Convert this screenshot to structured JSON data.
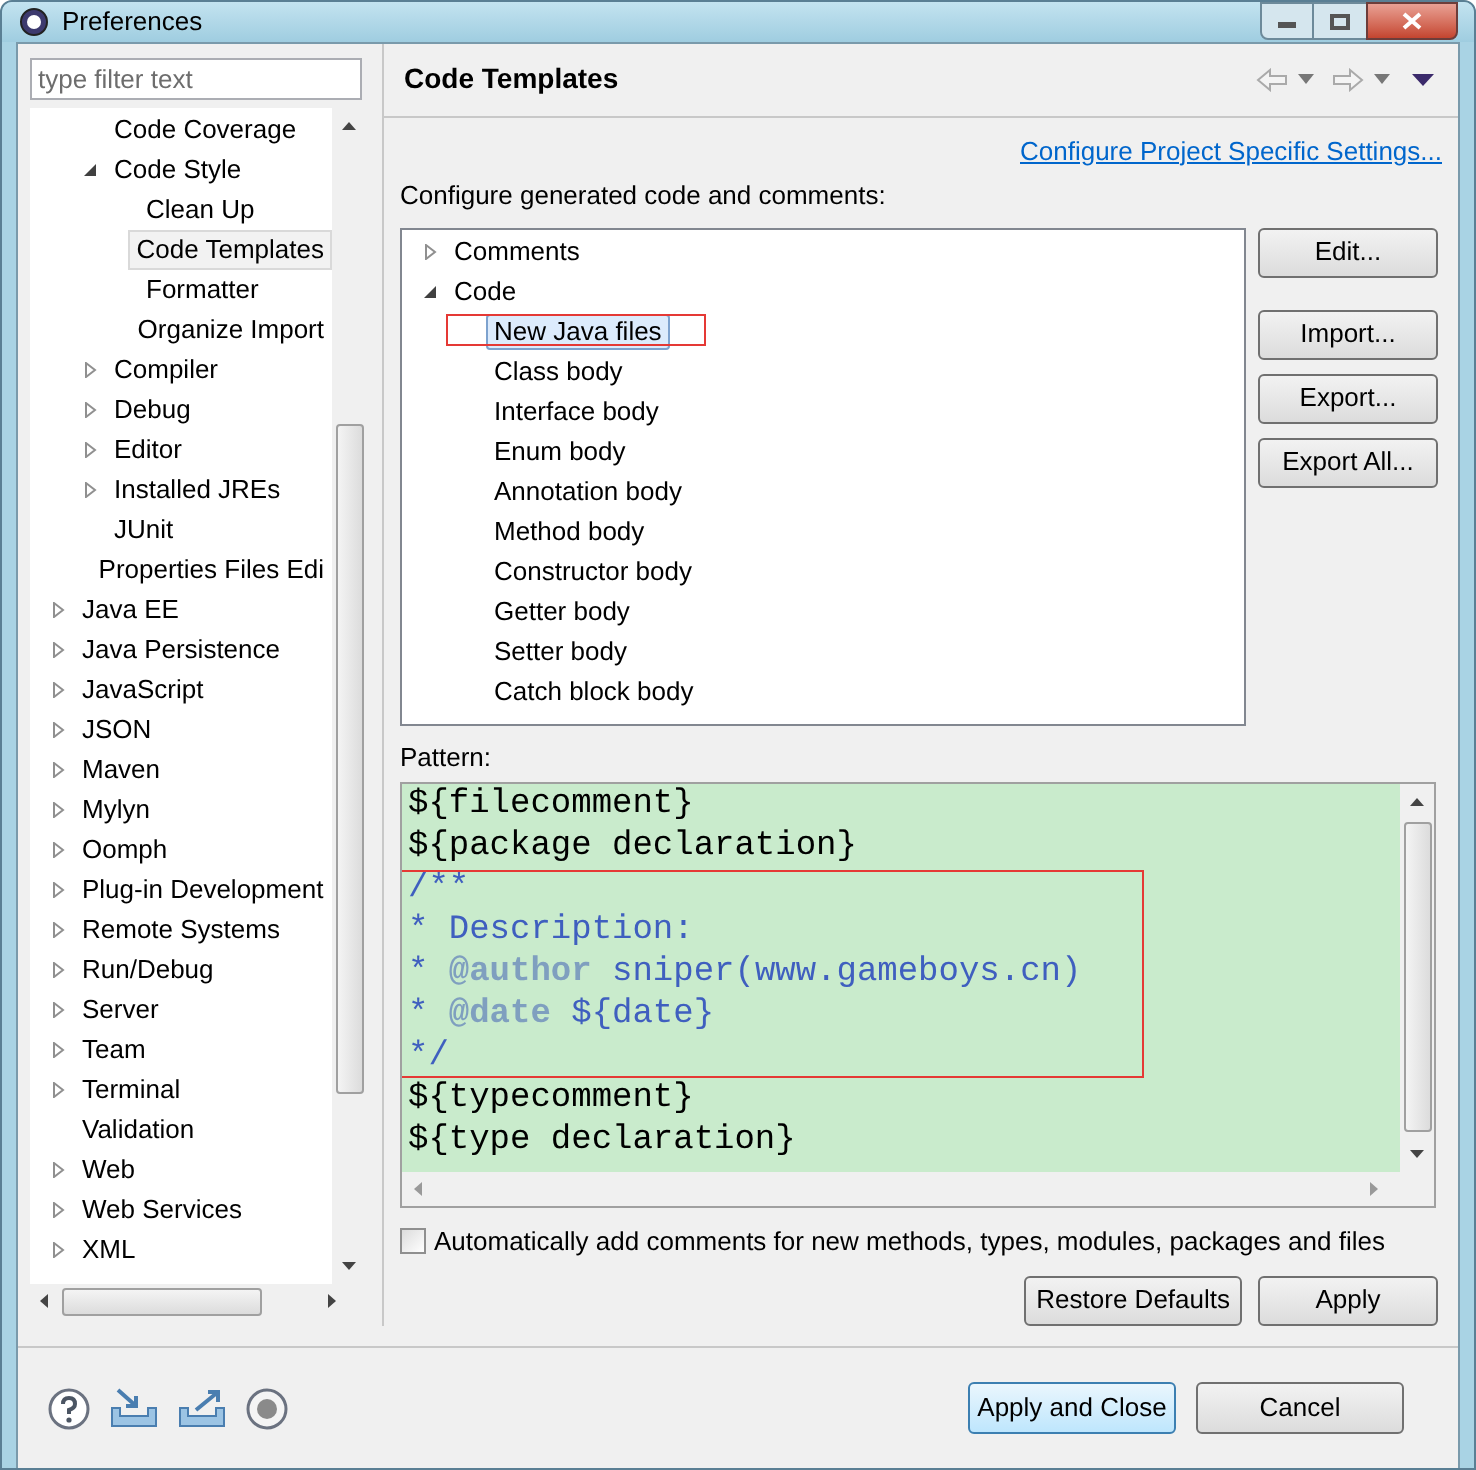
{
  "window": {
    "title": "Preferences"
  },
  "filter": {
    "placeholder": "type filter text"
  },
  "tree": {
    "scrolled_branch": [
      {
        "label": "Code Coverage",
        "expandable": false,
        "expanded": false,
        "selected": false
      },
      {
        "label": "Code Style",
        "expandable": true,
        "expanded": true,
        "selected": false,
        "children": [
          {
            "label": "Clean Up",
            "expandable": false,
            "expanded": false,
            "selected": false
          },
          {
            "label": "Code Templates",
            "expandable": false,
            "expanded": false,
            "selected": true
          },
          {
            "label": "Formatter",
            "expandable": false,
            "expanded": false,
            "selected": false
          },
          {
            "label": "Organize Import",
            "expandable": false,
            "expanded": false,
            "selected": false
          }
        ]
      },
      {
        "label": "Compiler",
        "expandable": true,
        "expanded": false,
        "selected": false
      },
      {
        "label": "Debug",
        "expandable": true,
        "expanded": false,
        "selected": false
      },
      {
        "label": "Editor",
        "expandable": true,
        "expanded": false,
        "selected": false
      },
      {
        "label": "Installed JREs",
        "expandable": true,
        "expanded": false,
        "selected": false
      },
      {
        "label": "JUnit",
        "expandable": false,
        "expanded": false,
        "selected": false
      },
      {
        "label": "Properties Files Edi",
        "expandable": false,
        "expanded": false,
        "selected": false
      }
    ],
    "items": [
      {
        "label": "Java EE",
        "expandable": true,
        "expanded": false,
        "selected": false
      },
      {
        "label": "Java Persistence",
        "expandable": true,
        "expanded": false,
        "selected": false
      },
      {
        "label": "JavaScript",
        "expandable": true,
        "expanded": false,
        "selected": false
      },
      {
        "label": "JSON",
        "expandable": true,
        "expanded": false,
        "selected": false
      },
      {
        "label": "Maven",
        "expandable": true,
        "expanded": false,
        "selected": false
      },
      {
        "label": "Mylyn",
        "expandable": true,
        "expanded": false,
        "selected": false
      },
      {
        "label": "Oomph",
        "expandable": true,
        "expanded": false,
        "selected": false
      },
      {
        "label": "Plug-in Development",
        "expandable": true,
        "expanded": false,
        "selected": false
      },
      {
        "label": "Remote Systems",
        "expandable": true,
        "expanded": false,
        "selected": false
      },
      {
        "label": "Run/Debug",
        "expandable": true,
        "expanded": false,
        "selected": false
      },
      {
        "label": "Server",
        "expandable": true,
        "expanded": false,
        "selected": false
      },
      {
        "label": "Team",
        "expandable": true,
        "expanded": false,
        "selected": false
      },
      {
        "label": "Terminal",
        "expandable": true,
        "expanded": false,
        "selected": false
      },
      {
        "label": "Validation",
        "expandable": false,
        "expanded": false,
        "selected": false
      },
      {
        "label": "Web",
        "expandable": true,
        "expanded": false,
        "selected": false
      },
      {
        "label": "Web Services",
        "expandable": true,
        "expanded": false,
        "selected": false
      },
      {
        "label": "XML",
        "expandable": true,
        "expanded": false,
        "selected": false
      }
    ]
  },
  "page": {
    "title": "Code Templates",
    "link": "Configure Project Specific Settings...",
    "intro": "Configure generated code and comments:"
  },
  "templates": [
    {
      "label": "Comments",
      "expandable": true,
      "expanded": false,
      "selected": false,
      "annotated": false
    },
    {
      "label": "Code",
      "expandable": true,
      "expanded": true,
      "selected": false,
      "annotated": false,
      "children": [
        {
          "label": "New Java files",
          "expandable": false,
          "expanded": false,
          "selected": true,
          "annotated": true
        },
        {
          "label": "Class body",
          "expandable": false,
          "expanded": false,
          "selected": false,
          "annotated": false
        },
        {
          "label": "Interface body",
          "expandable": false,
          "expanded": false,
          "selected": false,
          "annotated": false
        },
        {
          "label": "Enum body",
          "expandable": false,
          "expanded": false,
          "selected": false,
          "annotated": false
        },
        {
          "label": "Annotation body",
          "expandable": false,
          "expanded": false,
          "selected": false,
          "annotated": false
        },
        {
          "label": "Method body",
          "expandable": false,
          "expanded": false,
          "selected": false,
          "annotated": false
        },
        {
          "label": "Constructor body",
          "expandable": false,
          "expanded": false,
          "selected": false,
          "annotated": false
        },
        {
          "label": "Getter body",
          "expandable": false,
          "expanded": false,
          "selected": false,
          "annotated": false
        },
        {
          "label": "Setter body",
          "expandable": false,
          "expanded": false,
          "selected": false,
          "annotated": false
        },
        {
          "label": "Catch block body",
          "expandable": false,
          "expanded": false,
          "selected": false,
          "annotated": false
        }
      ]
    }
  ],
  "side_buttons": [
    "Edit...",
    "Import...",
    "Export...",
    "Export All..."
  ],
  "pattern": {
    "label": "Pattern:",
    "blocks": [
      {
        "annotated": false,
        "lines": [
          [
            {
              "text": "${filecomment}",
              "kind": "variable"
            }
          ],
          [
            {
              "text": "${package declaration}",
              "kind": "variable"
            }
          ]
        ]
      },
      {
        "annotated": true,
        "lines": [
          [
            {
              "text": "/**",
              "kind": "comment"
            }
          ],
          [
            {
              "text": "* Description:",
              "kind": "comment"
            }
          ],
          [
            {
              "text": "* ",
              "kind": "comment"
            },
            {
              "text": "@author",
              "kind": "tag"
            },
            {
              "text": " sniper(www.gameboys.cn)",
              "kind": "comment"
            }
          ],
          [
            {
              "text": "* ",
              "kind": "comment"
            },
            {
              "text": "@date",
              "kind": "tag"
            },
            {
              "text": " ${date}",
              "kind": "comment"
            }
          ],
          [
            {
              "text": "*/",
              "kind": "comment"
            }
          ]
        ]
      },
      {
        "annotated": false,
        "lines": [
          [
            {
              "text": "${typecomment}",
              "kind": "variable"
            }
          ],
          [
            {
              "text": "${type declaration}",
              "kind": "variable"
            }
          ]
        ]
      }
    ]
  },
  "auto_comments": {
    "label": "Automatically add comments for new methods, types, modules, packages and files",
    "checked": false
  },
  "page_buttons": [
    "Restore Defaults",
    "Apply"
  ],
  "dialog_buttons": [
    {
      "label": "Apply and Close",
      "default": true
    },
    {
      "label": "Cancel",
      "default": false
    }
  ]
}
